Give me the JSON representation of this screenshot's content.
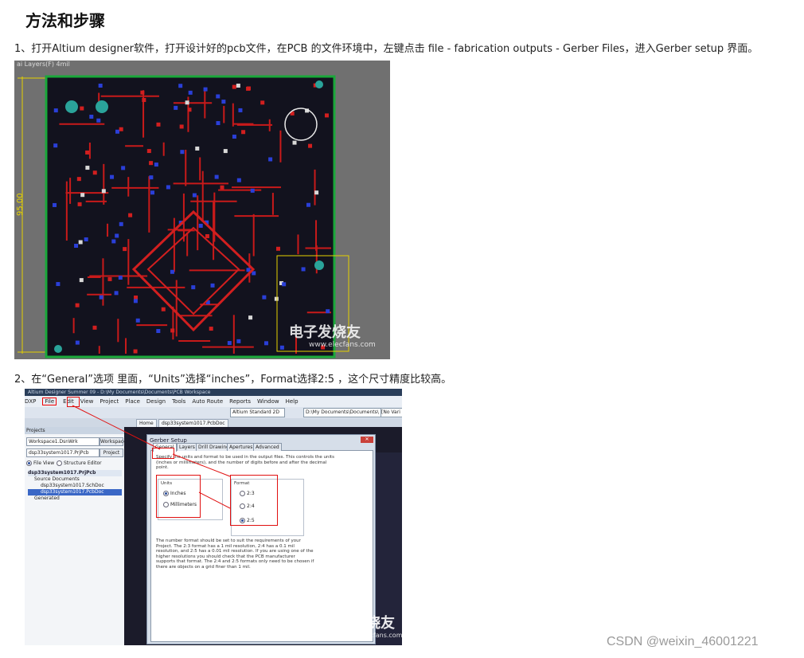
{
  "heading": "方法和步骤",
  "steps": {
    "step1": "1、打开Altium designer软件，打开设计好的pcb文件，在PCB 的文件环境中，左键点击 file - fabrication outputs - Gerber Files，进入Gerber setup 界面。",
    "step2": "2、在“General”选项 里面，“Units”选择“inches”，Format选择2:5 ，这个尺寸精度比较高。"
  },
  "pcb_figure": {
    "dimension_label": "95.00",
    "watermark": "电子发烧友",
    "watermark_url": "www.elecfans.com"
  },
  "gerber_figure": {
    "menu": [
      "DXP",
      "File",
      "Edit",
      "View",
      "Project",
      "Place",
      "Design",
      "Tools",
      "Auto Route",
      "Reports",
      "Window",
      "Help"
    ],
    "path_field": "D:\\My Documents\\Documents\\",
    "standard_field": "Altium Standard 2D",
    "novar_field": "[No Vari",
    "doc_tabs": [
      "Home",
      "dsp33system1017.PcbDoc"
    ],
    "projects_panel": {
      "title": "Projects",
      "workspace_field": "Workspace1.DsnWrk",
      "workspace_button": "Workspace",
      "project_field": "dsp33system1017.PrjPcb",
      "project_button": "Project",
      "view_option_1": "File View",
      "view_option_2": "Structure Editor",
      "tree": [
        "dsp33system1017.PrjPcb",
        "Source Documents",
        "dsp33system1017.SchDoc",
        "dsp33system1017.PcbDoc",
        "Generated"
      ]
    },
    "dialog": {
      "title": "Gerber Setup",
      "tabs": [
        "General",
        "Layers",
        "Drill Drawing",
        "Apertures",
        "Advanced"
      ],
      "intro": "Specify the units and format to be used in the output files. This controls the units (inches or millimeters), and the number of digits before and after the decimal point.",
      "units_label": "Units",
      "unit_options": [
        "Inches",
        "Millimeters"
      ],
      "format_label": "Format",
      "format_options": [
        "2:3",
        "2:4",
        "2:5"
      ],
      "note": "The number format should be set to suit the requirements of your Project. The 2:3 format has a 1 mil resolution, 2:4 has a 0.1 mil resolution, and 2:5 has a 0.01 mil resolution. If you are using one of the higher resolutions you should check that the PCB manufacturer supports that format. The 2:4 and 2:5 formats only need to be chosen if there are objects on a grid finer than 1 mil."
    },
    "watermark": "电子发烧友",
    "watermark_url": "www.elecfans.com"
  },
  "footer_watermark": "CSDN @weixin_46001221"
}
